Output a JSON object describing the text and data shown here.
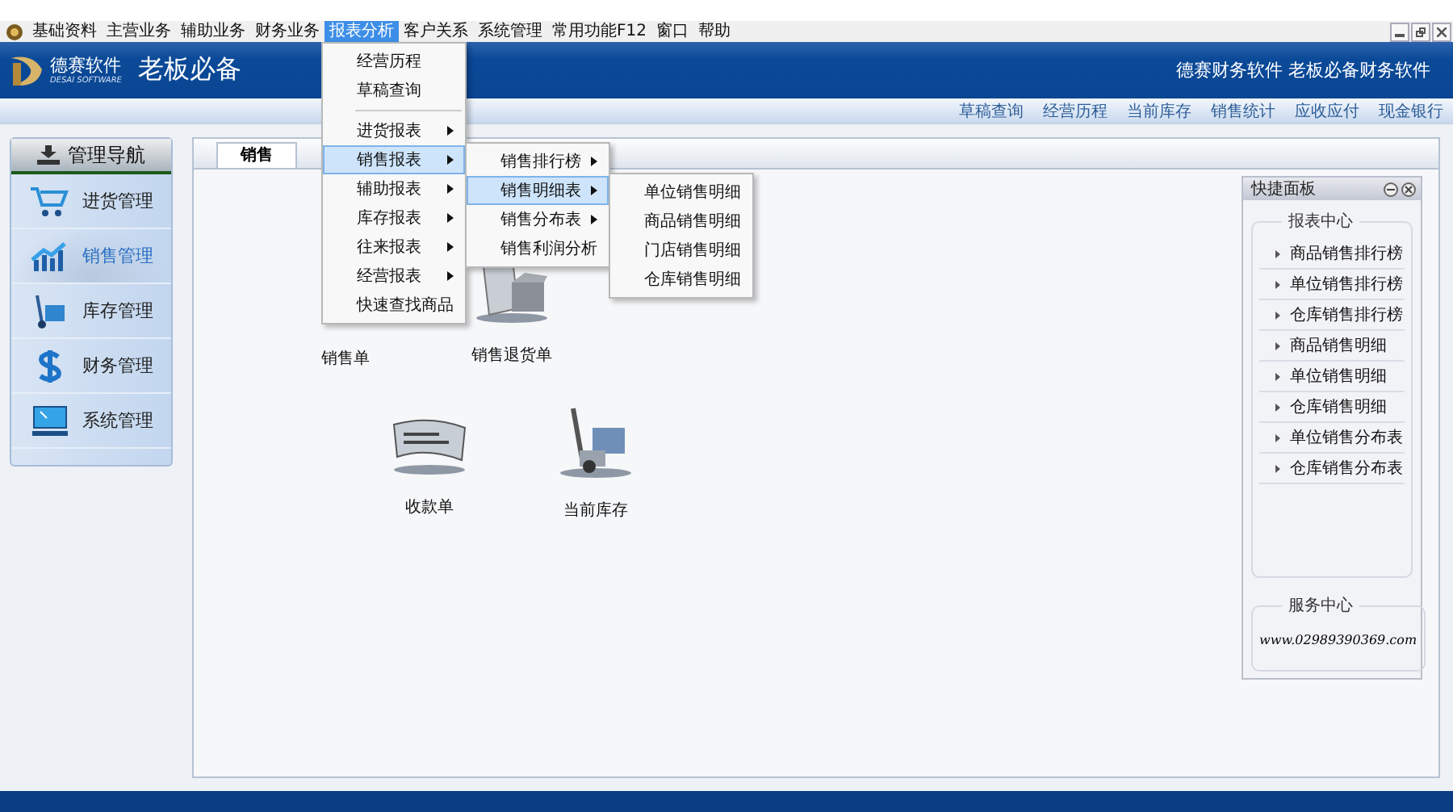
{
  "menubar": [
    {
      "label": "基础资料",
      "selected": false
    },
    {
      "label": "主营业务",
      "selected": false
    },
    {
      "label": "辅助业务",
      "selected": false
    },
    {
      "label": "财务业务",
      "selected": false
    },
    {
      "label": "报表分析",
      "selected": true,
      "menu": [
        {
          "kind": "item",
          "label": "经营历程",
          "has_submenu": false,
          "selected": false
        },
        {
          "kind": "item",
          "label": "草稿查询",
          "has_submenu": false,
          "selected": false
        },
        {
          "kind": "separator"
        },
        {
          "kind": "item",
          "label": "进货报表",
          "has_submenu": true,
          "selected": false
        },
        {
          "kind": "item",
          "label": "销售报表",
          "has_submenu": true,
          "selected": true,
          "submenu": [
            {
              "kind": "item",
              "label": "销售排行榜",
              "has_submenu": true,
              "selected": false
            },
            {
              "kind": "item",
              "label": "销售明细表",
              "has_submenu": true,
              "selected": true,
              "submenu": [
                {
                  "kind": "item",
                  "label": "单位销售明细",
                  "has_submenu": false,
                  "selected": false
                },
                {
                  "kind": "item",
                  "label": "商品销售明细",
                  "has_submenu": false,
                  "selected": false
                },
                {
                  "kind": "item",
                  "label": "门店销售明细",
                  "has_submenu": false,
                  "selected": false
                },
                {
                  "kind": "item",
                  "label": "仓库销售明细",
                  "has_submenu": false,
                  "selected": false
                }
              ]
            },
            {
              "kind": "item",
              "label": "销售分布表",
              "has_submenu": true,
              "selected": false
            },
            {
              "kind": "item",
              "label": "销售利润分析",
              "has_submenu": false,
              "selected": false
            }
          ]
        },
        {
          "kind": "item",
          "label": "辅助报表",
          "has_submenu": true,
          "selected": false
        },
        {
          "kind": "item",
          "label": "库存报表",
          "has_submenu": true,
          "selected": false
        },
        {
          "kind": "item",
          "label": "往来报表",
          "has_submenu": true,
          "selected": false
        },
        {
          "kind": "item",
          "label": "经营报表",
          "has_submenu": true,
          "selected": false
        },
        {
          "kind": "item",
          "label": "快速查找商品",
          "has_submenu": false,
          "selected": false
        }
      ]
    },
    {
      "label": "客户关系",
      "selected": false
    },
    {
      "label": "系统管理",
      "selected": false
    },
    {
      "label": "常用功能F12",
      "selected": false
    },
    {
      "label": "窗口",
      "selected": false
    },
    {
      "label": "帮助",
      "selected": false
    }
  ],
  "banner": {
    "logo_name": "德赛软件",
    "logo_sub": "DESAI SOFTWARE",
    "logo_slogan": "老板必备",
    "slogan": "德赛财务软件 老板必备财务软件"
  },
  "quick_links": [
    "草稿查询",
    "经营历程",
    "当前库存",
    "销售统计",
    "应收应付",
    "现金银行"
  ],
  "navigation": {
    "title": "管理导航",
    "items": [
      {
        "label": "进货管理",
        "kind": "cart",
        "selected": false
      },
      {
        "label": "销售管理",
        "kind": "chart",
        "selected": true
      },
      {
        "label": "库存管理",
        "kind": "truck",
        "selected": false
      },
      {
        "label": "财务管理",
        "kind": "dollar",
        "selected": false
      },
      {
        "label": "系统管理",
        "kind": "monitor",
        "selected": false
      }
    ]
  },
  "tab": {
    "label": "销售"
  },
  "shortcuts": [
    {
      "label": "销售单",
      "kind": "hidden"
    },
    {
      "label": "销售退货单",
      "kind": "box"
    },
    {
      "label": "收款单",
      "kind": "cheque"
    },
    {
      "label": "当前库存",
      "kind": "truck"
    }
  ],
  "quick_panel": {
    "title": "快捷面板",
    "report_title": "报表中心",
    "reports": [
      "商品销售排行榜",
      "单位销售排行榜",
      "仓库销售排行榜",
      "商品销售明细",
      "单位销售明细",
      "仓库销售明细",
      "单位销售分布表",
      "仓库销售分布表"
    ],
    "service_title": "服务中心",
    "service_url": "www.02989390369.com"
  }
}
